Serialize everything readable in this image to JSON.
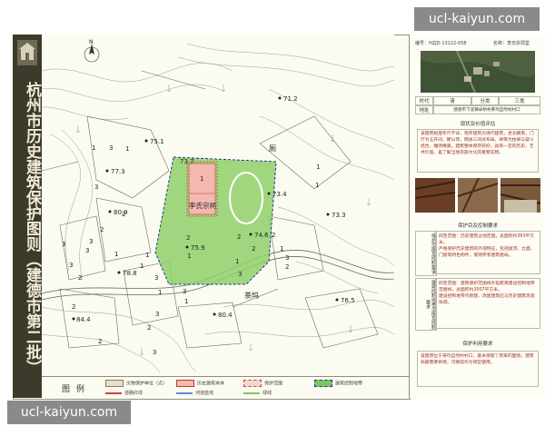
{
  "banner": {
    "title": "杭州市历史建筑保护图则（建德市第二批）"
  },
  "watermarks": {
    "top": "ucl-kaiyun.com",
    "bottom": "ucl-kaiyun.com"
  },
  "map": {
    "compass_label": "N",
    "building_name": "李氏宗祠",
    "landmarks": {
      "toilet": "厕",
      "tea": "茶坞"
    },
    "building_number": "1",
    "elevations": [
      "71.2",
      "75.1",
      "77.3",
      "80.9",
      "73.4",
      "73.3",
      "75.9",
      "74.6",
      "78.8",
      "84.4",
      "80.4",
      "76.5",
      "73.7"
    ],
    "plot_numbers": [
      "1",
      "3",
      "1",
      "3",
      "3",
      "2",
      "2",
      "3",
      "3",
      "1",
      "3",
      "2",
      "3",
      "1",
      "3",
      "1",
      "3",
      "1",
      "2",
      "2",
      "2",
      "3",
      "2",
      "2",
      "1",
      "3",
      "2",
      "2",
      "1",
      "1",
      "1",
      "1",
      "2",
      "1",
      "3"
    ]
  },
  "legend": {
    "title": "图  例",
    "items": [
      {
        "label": "文物保护单位（点）",
        "color": "#e9dfc8"
      },
      {
        "label": "历史建筑本体",
        "color": "#f4b8b0"
      },
      {
        "label": "保护范围",
        "color": "#d04030"
      },
      {
        "label": "建筑控制地带",
        "color": "#7cc860"
      },
      {
        "label": "道路红线",
        "color": "#d04030"
      },
      {
        "label": "河道蓝线",
        "color": "#5a8cd8"
      },
      {
        "label": "绿线",
        "color": "#7cc860"
      }
    ]
  },
  "panel": {
    "code": "编号：HZJD-13122-058",
    "name": "名称：李氏宗祠堂",
    "era_label": "时代",
    "era_value": "清",
    "category_label": "分类",
    "category_value": "三类",
    "address_label": "地址",
    "address_value": "建德市下涯镇卓桥村茶坞自然村村口",
    "status_title": "现状及价值评估",
    "status_text": "该建筑始建年代不详，现存建筑为清代建筑，坐北朝南，门厅为五开间，硬山顶，两进三间式布局。梁架为抬梁与穿斗结合，雕饰精美。建筑整体保存较好，具有一定的历史、艺术价值，是了解当地宗族文化的重要实物。",
    "protect_title": "保护目及控制要求",
    "protect_label_1": "保护范围及控制要求",
    "protect_text_1": "四至范围：历史建筑占地范围，总面积约363平方米。\n严格保护历史建筑的外观特征，包括屋顶、立面、门窗等特色构件。保持原有建筑格局。",
    "protect_label_2": "建筑控制地带范围及控制要求",
    "protect_text_2": "四至范围：建筑保护范围线外延距离建设控制地带范围线，总面积约2007平方米。\n建设控制地带内新建、改建建筑应与历史建筑风貌协调。",
    "use_title": "保护利用要求",
    "use_text": "该建筑位于茶坞自然村村口，基本保留了原来的面貌，建筑局部需要修缮，可继续作为祠堂使用。"
  },
  "colors": {
    "banner": "#3d3a2b",
    "building_fill": "#f4b8b0",
    "zone_fill": "#8fd06a",
    "zone_line": "#1a3a8a",
    "red": "#d04030"
  }
}
